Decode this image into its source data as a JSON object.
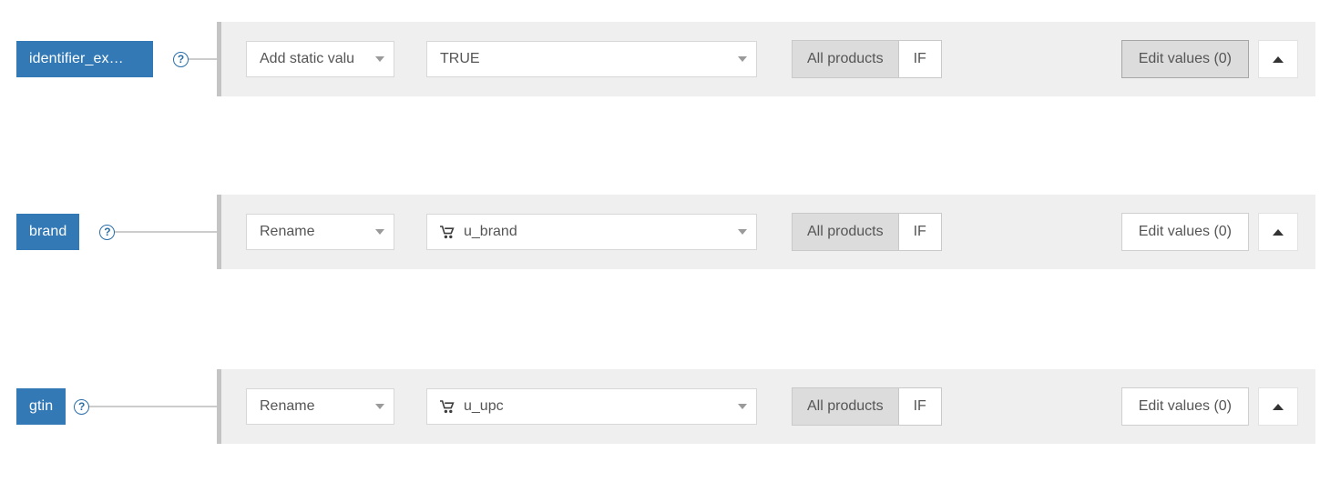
{
  "colors": {
    "tag_blue": "#3379b5",
    "panel_bg": "#efefef",
    "panel_accent": "#c4c4c4",
    "connector": "#cccccc",
    "help_blue": "#2a6ea8",
    "active_gray": "#dcdcdc"
  },
  "rows": [
    {
      "field_label": "identifier_ex…",
      "help_icon": "question-mark-circle-icon",
      "action": {
        "value": "Add static valu",
        "caret": "chevron-down-icon"
      },
      "value": {
        "value": "TRUE",
        "icon": null,
        "caret": "chevron-down-icon"
      },
      "scope": {
        "options": [
          "All products",
          "IF"
        ],
        "selected": "All products"
      },
      "edit_values": {
        "label": "Edit values (0)",
        "pressed": true
      },
      "collapse": {
        "icon": "caret-up-icon"
      }
    },
    {
      "field_label": "brand",
      "help_icon": "question-mark-circle-icon",
      "action": {
        "value": "Rename",
        "caret": "chevron-down-icon"
      },
      "value": {
        "value": "u_brand",
        "icon": "shopping-cart-icon",
        "caret": "chevron-down-icon"
      },
      "scope": {
        "options": [
          "All products",
          "IF"
        ],
        "selected": "All products"
      },
      "edit_values": {
        "label": "Edit values (0)",
        "pressed": false
      },
      "collapse": {
        "icon": "caret-up-icon"
      }
    },
    {
      "field_label": "gtin",
      "help_icon": "question-mark-circle-icon",
      "action": {
        "value": "Rename",
        "caret": "chevron-down-icon"
      },
      "value": {
        "value": "u_upc",
        "icon": "shopping-cart-icon",
        "caret": "chevron-down-icon"
      },
      "scope": {
        "options": [
          "All products",
          "IF"
        ],
        "selected": "All products"
      },
      "edit_values": {
        "label": "Edit values (0)",
        "pressed": false
      },
      "collapse": {
        "icon": "caret-up-icon"
      }
    }
  ],
  "help_glyph": "?"
}
